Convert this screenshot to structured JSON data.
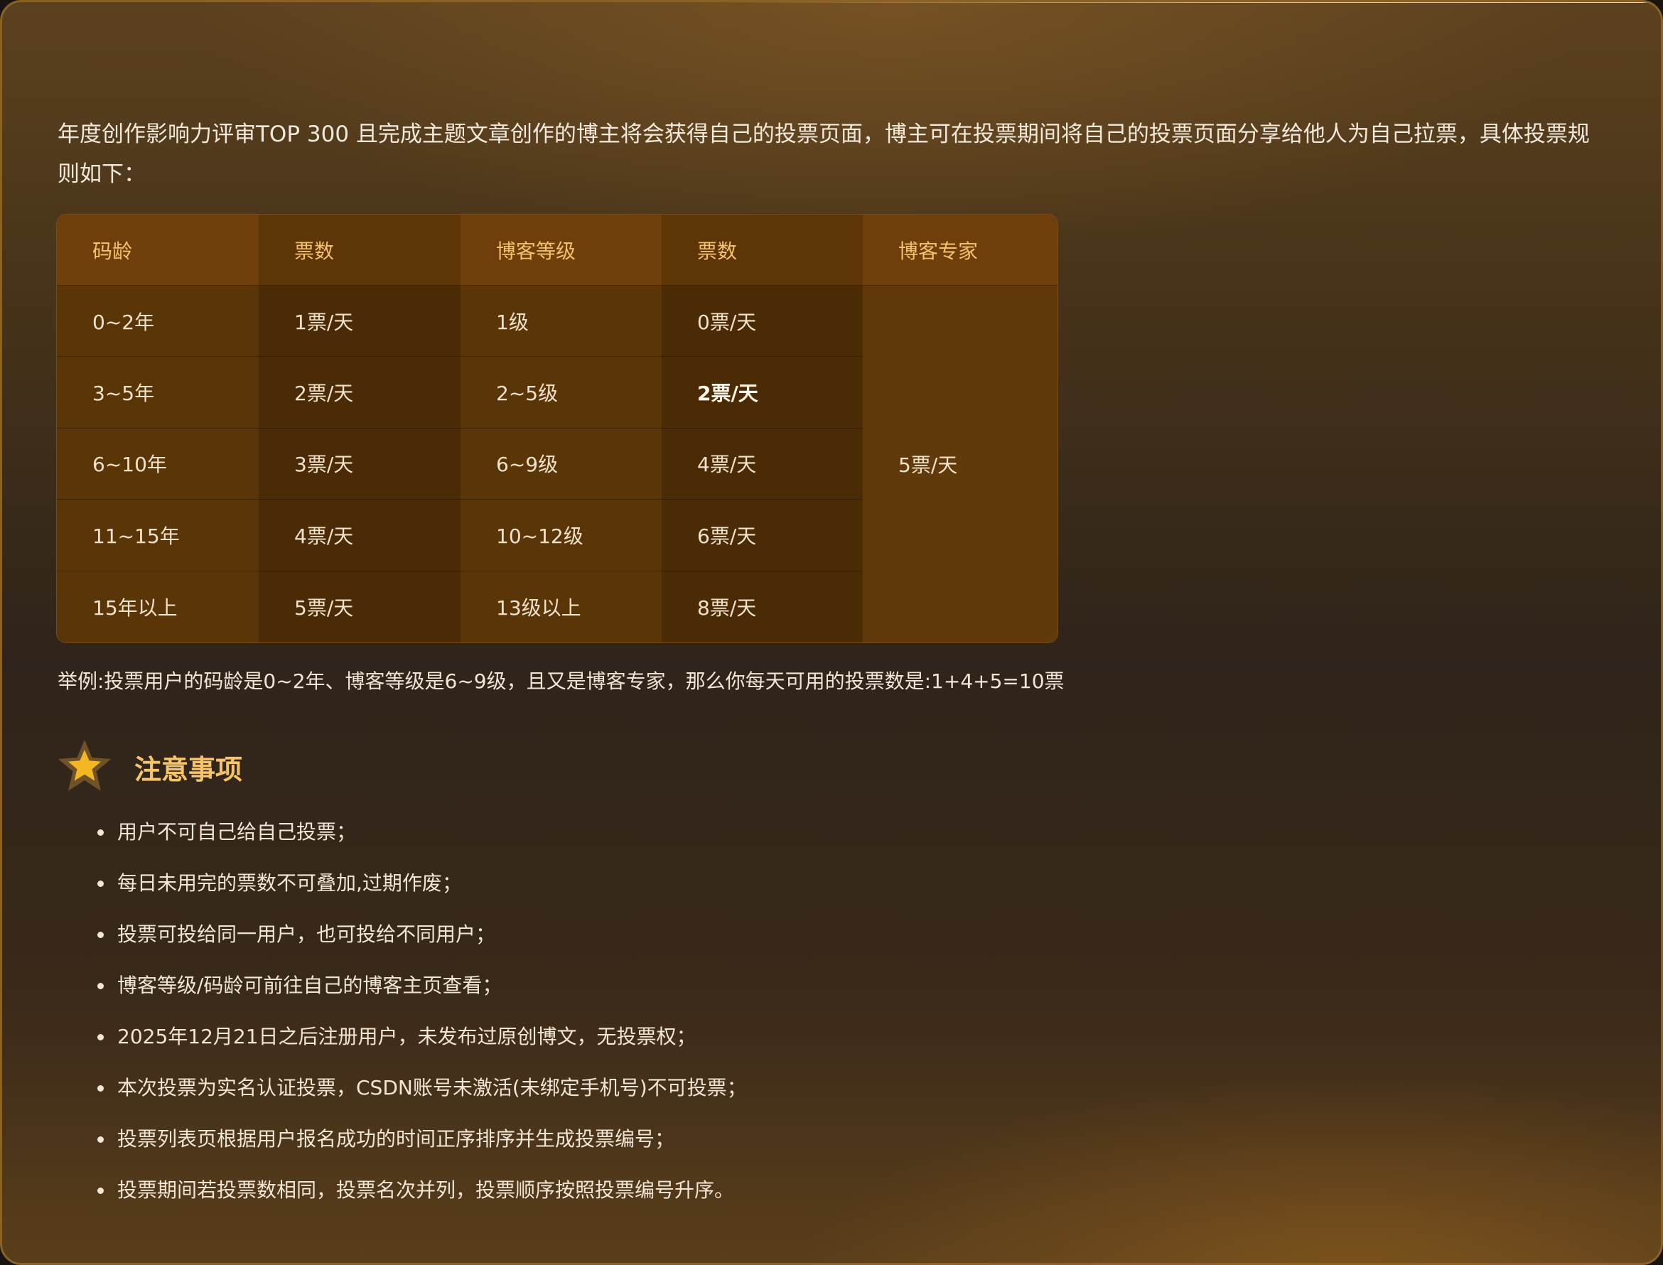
{
  "intro": "年度创作影响力评审TOP 300 且完成主题文章创作的博主将会获得自己的投票页面，博主可在投票期间将自己的投票页面分享给他人为自己拉票，具体投票规则如下：",
  "table": {
    "headers": [
      "码龄",
      "票数",
      "博客等级",
      "票数",
      "博客专家"
    ],
    "rows": [
      [
        "0~2年",
        "1票/天",
        "1级",
        "0票/天"
      ],
      [
        "3~5年",
        "2票/天",
        "2~5级",
        "2票/天"
      ],
      [
        "6~10年",
        "3票/天",
        "6~9级",
        "4票/天"
      ],
      [
        "11~15年",
        "4票/天",
        "10~12级",
        "6票/天"
      ],
      [
        "15年以上",
        "5票/天",
        "13级以上",
        "8票/天"
      ]
    ],
    "expert_votes": "5票/天"
  },
  "example": "举例:投票用户的码龄是0~2年、博客等级是6~9级，且又是博客专家，那么你每天可用的投票数是:1+4+5=10票",
  "notice": {
    "icon": "star-icon",
    "title": "注意事项",
    "items": [
      "用户不可自己给自己投票；",
      "每日未用完的票数不可叠加,过期作废；",
      "投票可投给同一用户，也可投给不同用户；",
      "博客等级/码龄可前往自己的博客主页查看；",
      "2025年12月21日之后注册用户，未发布过原创博文，无投票权；",
      "本次投票为实名认证投票，CSDN账号未激活(未绑定手机号)不可投票；",
      "投票列表页根据用户报名成功的时间正序排序并生成投票编号；",
      "投票期间若投票数相同，投票名次并列，投票顺序按照投票编号升序。"
    ]
  },
  "colors": {
    "accent": "#f6c46a",
    "table_header": "#6e3f0a",
    "table_cell": "#5a3508",
    "table_cell_alt": "#4b2b06",
    "border_gold": "#f3c45c"
  }
}
